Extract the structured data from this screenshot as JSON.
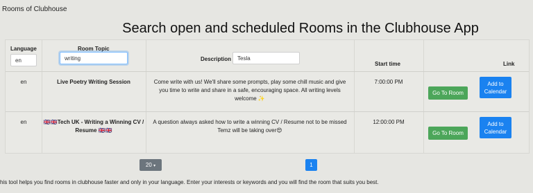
{
  "app": {
    "brand": "Rooms of Clubhouse"
  },
  "header": {
    "title": "Search open and scheduled Rooms in the Clubhouse App"
  },
  "filters": {
    "language_label": "Language",
    "language_value": "en",
    "topic_label": "Room Topic",
    "topic_value": "writing",
    "description_label": "Description",
    "description_value": "Tesla"
  },
  "columns": {
    "start_time": "Start time",
    "link": "Link"
  },
  "rows": [
    {
      "language": "en",
      "topic": "Live Poetry Writing Session",
      "description": "Come write with us! We'll share some prompts, play some chill music and give you time to write and share in a safe, encouraging space. All writing levels welcome ✨",
      "start_time": "7:00:00 PM",
      "go_label": "Go To Room",
      "calendar_label": "Add to Calendar"
    },
    {
      "language": "en",
      "topic": "🇬🇧🇬🇧Tech UK - Writing a Winning CV / Resume 🇬🇧🇬🇧",
      "description": "A question always asked how to write a winning CV / Resume not to be missed Temz will be taking over😍",
      "start_time": "12:00:00 PM",
      "go_label": "Go To Room",
      "calendar_label": "Add to Calendar"
    }
  ],
  "pagination": {
    "page_size": "20",
    "current_page": "1"
  },
  "footer": {
    "text": "his tool helps you find rooms in clubhouse faster and only in your language. Enter your interests or keywords and you will find the room that suits you best."
  },
  "colors": {
    "green": "#4ca65a",
    "blue": "#1a82f0",
    "gray": "#6c757d"
  }
}
